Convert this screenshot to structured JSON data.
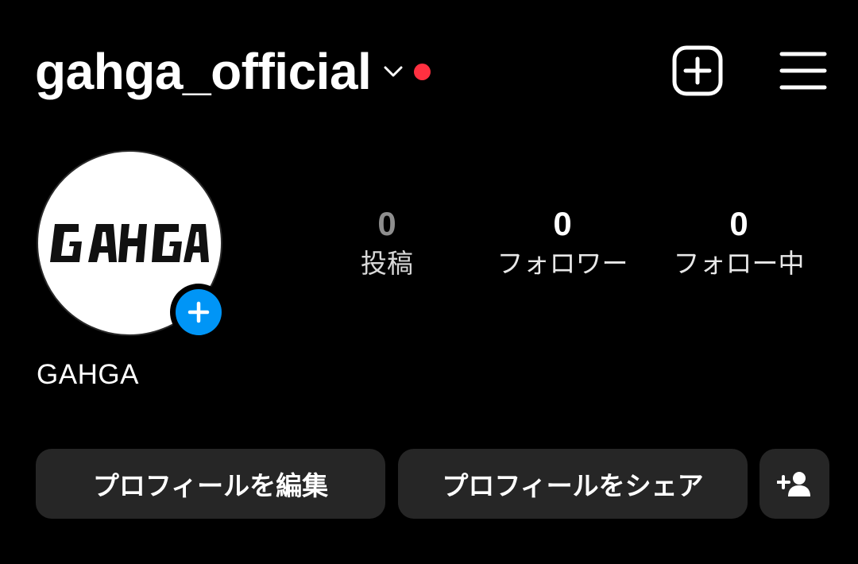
{
  "header": {
    "username": "gahga_official",
    "chevron_icon": "chevron-down-icon",
    "has_notification": true,
    "create_icon": "plus-square-icon",
    "menu_icon": "hamburger-menu-icon"
  },
  "profile": {
    "avatar_logo_text": "GAHGA",
    "avatar_add_icon": "plus-icon",
    "display_name": "GAHGA"
  },
  "stats": [
    {
      "count": "0",
      "label": "投稿"
    },
    {
      "count": "0",
      "label": "フォロワー"
    },
    {
      "count": "0",
      "label": "フォロー中"
    }
  ],
  "actions": {
    "edit_profile_label": "プロフィールを編集",
    "share_profile_label": "プロフィールをシェア",
    "suggest_icon": "add-person-icon"
  },
  "colors": {
    "background": "#000000",
    "text": "#ffffff",
    "notification_dot": "#ff3040",
    "accent_blue": "#0095f6",
    "button_bg": "#262626",
    "muted_count": "#8e8e8e"
  }
}
